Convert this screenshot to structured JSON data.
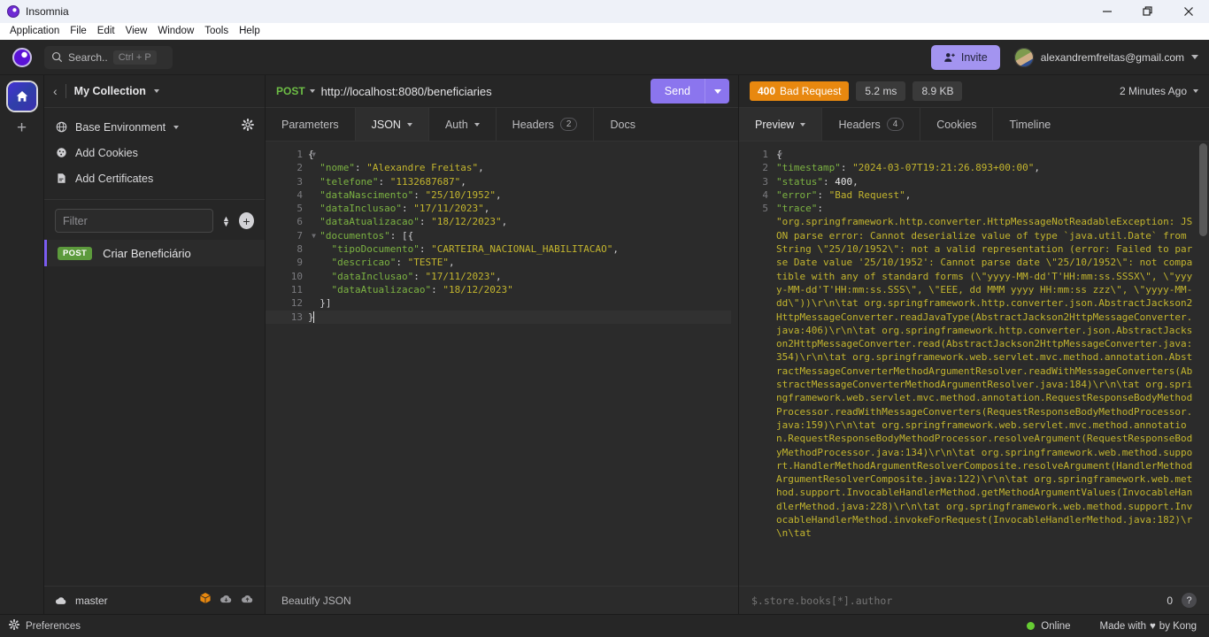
{
  "titlebar": {
    "app_name": "Insomnia",
    "minimize": "minimize-icon",
    "restore": "restore-icon",
    "close": "close-icon"
  },
  "menubar": {
    "items": [
      "Application",
      "File",
      "Edit",
      "View",
      "Window",
      "Tools",
      "Help"
    ]
  },
  "header": {
    "search_label": "Search..",
    "search_shortcut": "Ctrl + P",
    "invite_label": "Invite",
    "account_email": "alexandremfreitas@gmail.com"
  },
  "sidebar": {
    "collection_name": "My Collection",
    "env_items": [
      {
        "label": "Base Environment",
        "icon": "globe-icon",
        "has_caret": true
      },
      {
        "label": "Add Cookies",
        "icon": "cookie-icon",
        "has_caret": false
      },
      {
        "label": "Add Certificates",
        "icon": "certificate-icon",
        "has_caret": false
      }
    ],
    "filter_placeholder": "Filter",
    "requests": [
      {
        "method": "POST",
        "name": "Criar Beneficiário"
      }
    ],
    "branch": "master"
  },
  "request": {
    "method": "POST",
    "url": "http://localhost:8080/beneficiaries",
    "send_label": "Send",
    "tabs": [
      {
        "label": "Parameters",
        "active": false,
        "caret": false,
        "count": null
      },
      {
        "label": "JSON",
        "active": true,
        "caret": true,
        "count": null
      },
      {
        "label": "Auth",
        "active": false,
        "caret": true,
        "count": null
      },
      {
        "label": "Headers",
        "active": false,
        "caret": false,
        "count": "2"
      },
      {
        "label": "Docs",
        "active": false,
        "caret": false,
        "count": null
      }
    ],
    "beautify_label": "Beautify JSON",
    "body_lines": [
      {
        "n": 1,
        "fold": true,
        "segments": [
          {
            "t": "{",
            "c": "p"
          }
        ]
      },
      {
        "n": 2,
        "fold": false,
        "segments": [
          {
            "t": "  \"nome\"",
            "c": "k"
          },
          {
            "t": ": ",
            "c": "p"
          },
          {
            "t": "\"Alexandre Freitas\"",
            "c": "s"
          },
          {
            "t": ",",
            "c": "p"
          }
        ]
      },
      {
        "n": 3,
        "fold": false,
        "segments": [
          {
            "t": "  \"telefone\"",
            "c": "k"
          },
          {
            "t": ": ",
            "c": "p"
          },
          {
            "t": "\"1132687687\"",
            "c": "s"
          },
          {
            "t": ",",
            "c": "p"
          }
        ]
      },
      {
        "n": 4,
        "fold": false,
        "segments": [
          {
            "t": "  \"dataNascimento\"",
            "c": "k"
          },
          {
            "t": ": ",
            "c": "p"
          },
          {
            "t": "\"25/10/1952\"",
            "c": "s"
          },
          {
            "t": ",",
            "c": "p"
          }
        ]
      },
      {
        "n": 5,
        "fold": false,
        "segments": [
          {
            "t": "  \"dataInclusao\"",
            "c": "k"
          },
          {
            "t": ": ",
            "c": "p"
          },
          {
            "t": "\"17/11/2023\"",
            "c": "s"
          },
          {
            "t": ",",
            "c": "p"
          }
        ]
      },
      {
        "n": 6,
        "fold": false,
        "segments": [
          {
            "t": "  \"dataAtualizacao\"",
            "c": "k"
          },
          {
            "t": ": ",
            "c": "p"
          },
          {
            "t": "\"18/12/2023\"",
            "c": "s"
          },
          {
            "t": ",",
            "c": "p"
          }
        ]
      },
      {
        "n": 7,
        "fold": true,
        "segments": [
          {
            "t": "  \"documentos\"",
            "c": "k"
          },
          {
            "t": ": [{",
            "c": "p"
          }
        ]
      },
      {
        "n": 8,
        "fold": false,
        "segments": [
          {
            "t": "    \"tipoDocumento\"",
            "c": "k"
          },
          {
            "t": ": ",
            "c": "p"
          },
          {
            "t": "\"CARTEIRA_NACIONAL_HABILITACAO\"",
            "c": "s"
          },
          {
            "t": ",",
            "c": "p"
          }
        ]
      },
      {
        "n": 9,
        "fold": false,
        "segments": [
          {
            "t": "    \"descricao\"",
            "c": "k"
          },
          {
            "t": ": ",
            "c": "p"
          },
          {
            "t": "\"TESTE\"",
            "c": "s"
          },
          {
            "t": ",",
            "c": "p"
          }
        ]
      },
      {
        "n": 10,
        "fold": false,
        "segments": [
          {
            "t": "    \"dataInclusao\"",
            "c": "k"
          },
          {
            "t": ": ",
            "c": "p"
          },
          {
            "t": "\"17/11/2023\"",
            "c": "s"
          },
          {
            "t": ",",
            "c": "p"
          }
        ]
      },
      {
        "n": 11,
        "fold": false,
        "segments": [
          {
            "t": "    \"dataAtualizacao\"",
            "c": "k"
          },
          {
            "t": ": ",
            "c": "p"
          },
          {
            "t": "\"18/12/2023\"",
            "c": "s"
          }
        ]
      },
      {
        "n": 12,
        "fold": false,
        "segments": [
          {
            "t": "  }]",
            "c": "p"
          }
        ]
      },
      {
        "n": 13,
        "fold": false,
        "active": true,
        "segments": [
          {
            "t": "}",
            "c": "p"
          }
        ]
      }
    ]
  },
  "response": {
    "status_code": "400",
    "status_text": "Bad Request",
    "time": "5.2 ms",
    "size": "8.9 KB",
    "time_ago": "2 Minutes Ago",
    "tabs": [
      {
        "label": "Preview",
        "active": true,
        "caret": true,
        "count": null
      },
      {
        "label": "Headers",
        "active": false,
        "caret": false,
        "count": "4"
      },
      {
        "label": "Cookies",
        "active": false,
        "caret": false,
        "count": null
      },
      {
        "label": "Timeline",
        "active": false,
        "caret": false,
        "count": null
      }
    ],
    "jsonpath_placeholder": "$.store.books[*].author",
    "result_count": "0",
    "body_lines": [
      {
        "n": 1,
        "fold": true,
        "segments": [
          {
            "t": "{",
            "c": "p"
          }
        ]
      },
      {
        "n": 2,
        "fold": false,
        "segments": [
          {
            "t": "  \"timestamp\"",
            "c": "k"
          },
          {
            "t": ": ",
            "c": "p"
          },
          {
            "t": "\"2024-03-07T19:21:26.893+00:00\"",
            "c": "s"
          },
          {
            "t": ",",
            "c": "p"
          }
        ]
      },
      {
        "n": 3,
        "fold": false,
        "segments": [
          {
            "t": "  \"status\"",
            "c": "k"
          },
          {
            "t": ": ",
            "c": "p"
          },
          {
            "t": "400",
            "c": "num"
          },
          {
            "t": ",",
            "c": "p"
          }
        ]
      },
      {
        "n": 4,
        "fold": false,
        "segments": [
          {
            "t": "  \"error\"",
            "c": "k"
          },
          {
            "t": ": ",
            "c": "p"
          },
          {
            "t": "\"Bad Request\"",
            "c": "s"
          },
          {
            "t": ",",
            "c": "p"
          }
        ]
      },
      {
        "n": 5,
        "fold": false,
        "segments": [
          {
            "t": "  \"trace\"",
            "c": "k"
          },
          {
            "t": ":",
            "c": "p"
          }
        ]
      }
    ],
    "trace_value": "\"org.springframework.http.converter.HttpMessageNotReadableException: JSON parse error: Cannot deserialize value of type `java.util.Date` from String \\\"25/10/1952\\\": not a valid representation (error: Failed to parse Date value '25/10/1952': Cannot parse date \\\"25/10/1952\\\": not compatible with any of standard forms (\\\"yyyy-MM-dd'T'HH:mm:ss.SSSX\\\", \\\"yyyy-MM-dd'T'HH:mm:ss.SSS\\\", \\\"EEE, dd MMM yyyy HH:mm:ss zzz\\\", \\\"yyyy-MM-dd\\\"))\\r\\n\\tat org.springframework.http.converter.json.AbstractJackson2HttpMessageConverter.readJavaType(AbstractJackson2HttpMessageConverter.java:406)\\r\\n\\tat org.springframework.http.converter.json.AbstractJackson2HttpMessageConverter.read(AbstractJackson2HttpMessageConverter.java:354)\\r\\n\\tat org.springframework.web.servlet.mvc.method.annotation.AbstractMessageConverterMethodArgumentResolver.readWithMessageConverters(AbstractMessageConverterMethodArgumentResolver.java:184)\\r\\n\\tat org.springframework.web.servlet.mvc.method.annotation.RequestResponseBodyMethodProcessor.readWithMessageConverters(RequestResponseBodyMethodProcessor.java:159)\\r\\n\\tat org.springframework.web.servlet.mvc.method.annotation.RequestResponseBodyMethodProcessor.resolveArgument(RequestResponseBodyMethodProcessor.java:134)\\r\\n\\tat org.springframework.web.method.support.HandlerMethodArgumentResolverComposite.resolveArgument(HandlerMethodArgumentResolverComposite.java:122)\\r\\n\\tat org.springframework.web.method.support.InvocableHandlerMethod.getMethodArgumentValues(InvocableHandlerMethod.java:228)\\r\\n\\tat org.springframework.web.method.support.InvocableHandlerMethod.invokeForRequest(InvocableHandlerMethod.java:182)\\r\\n\\tat"
  },
  "statusbar": {
    "preferences_label": "Preferences",
    "online_label": "Online",
    "made_with_prefix": "Made with",
    "made_with_suffix": "by Kong"
  }
}
